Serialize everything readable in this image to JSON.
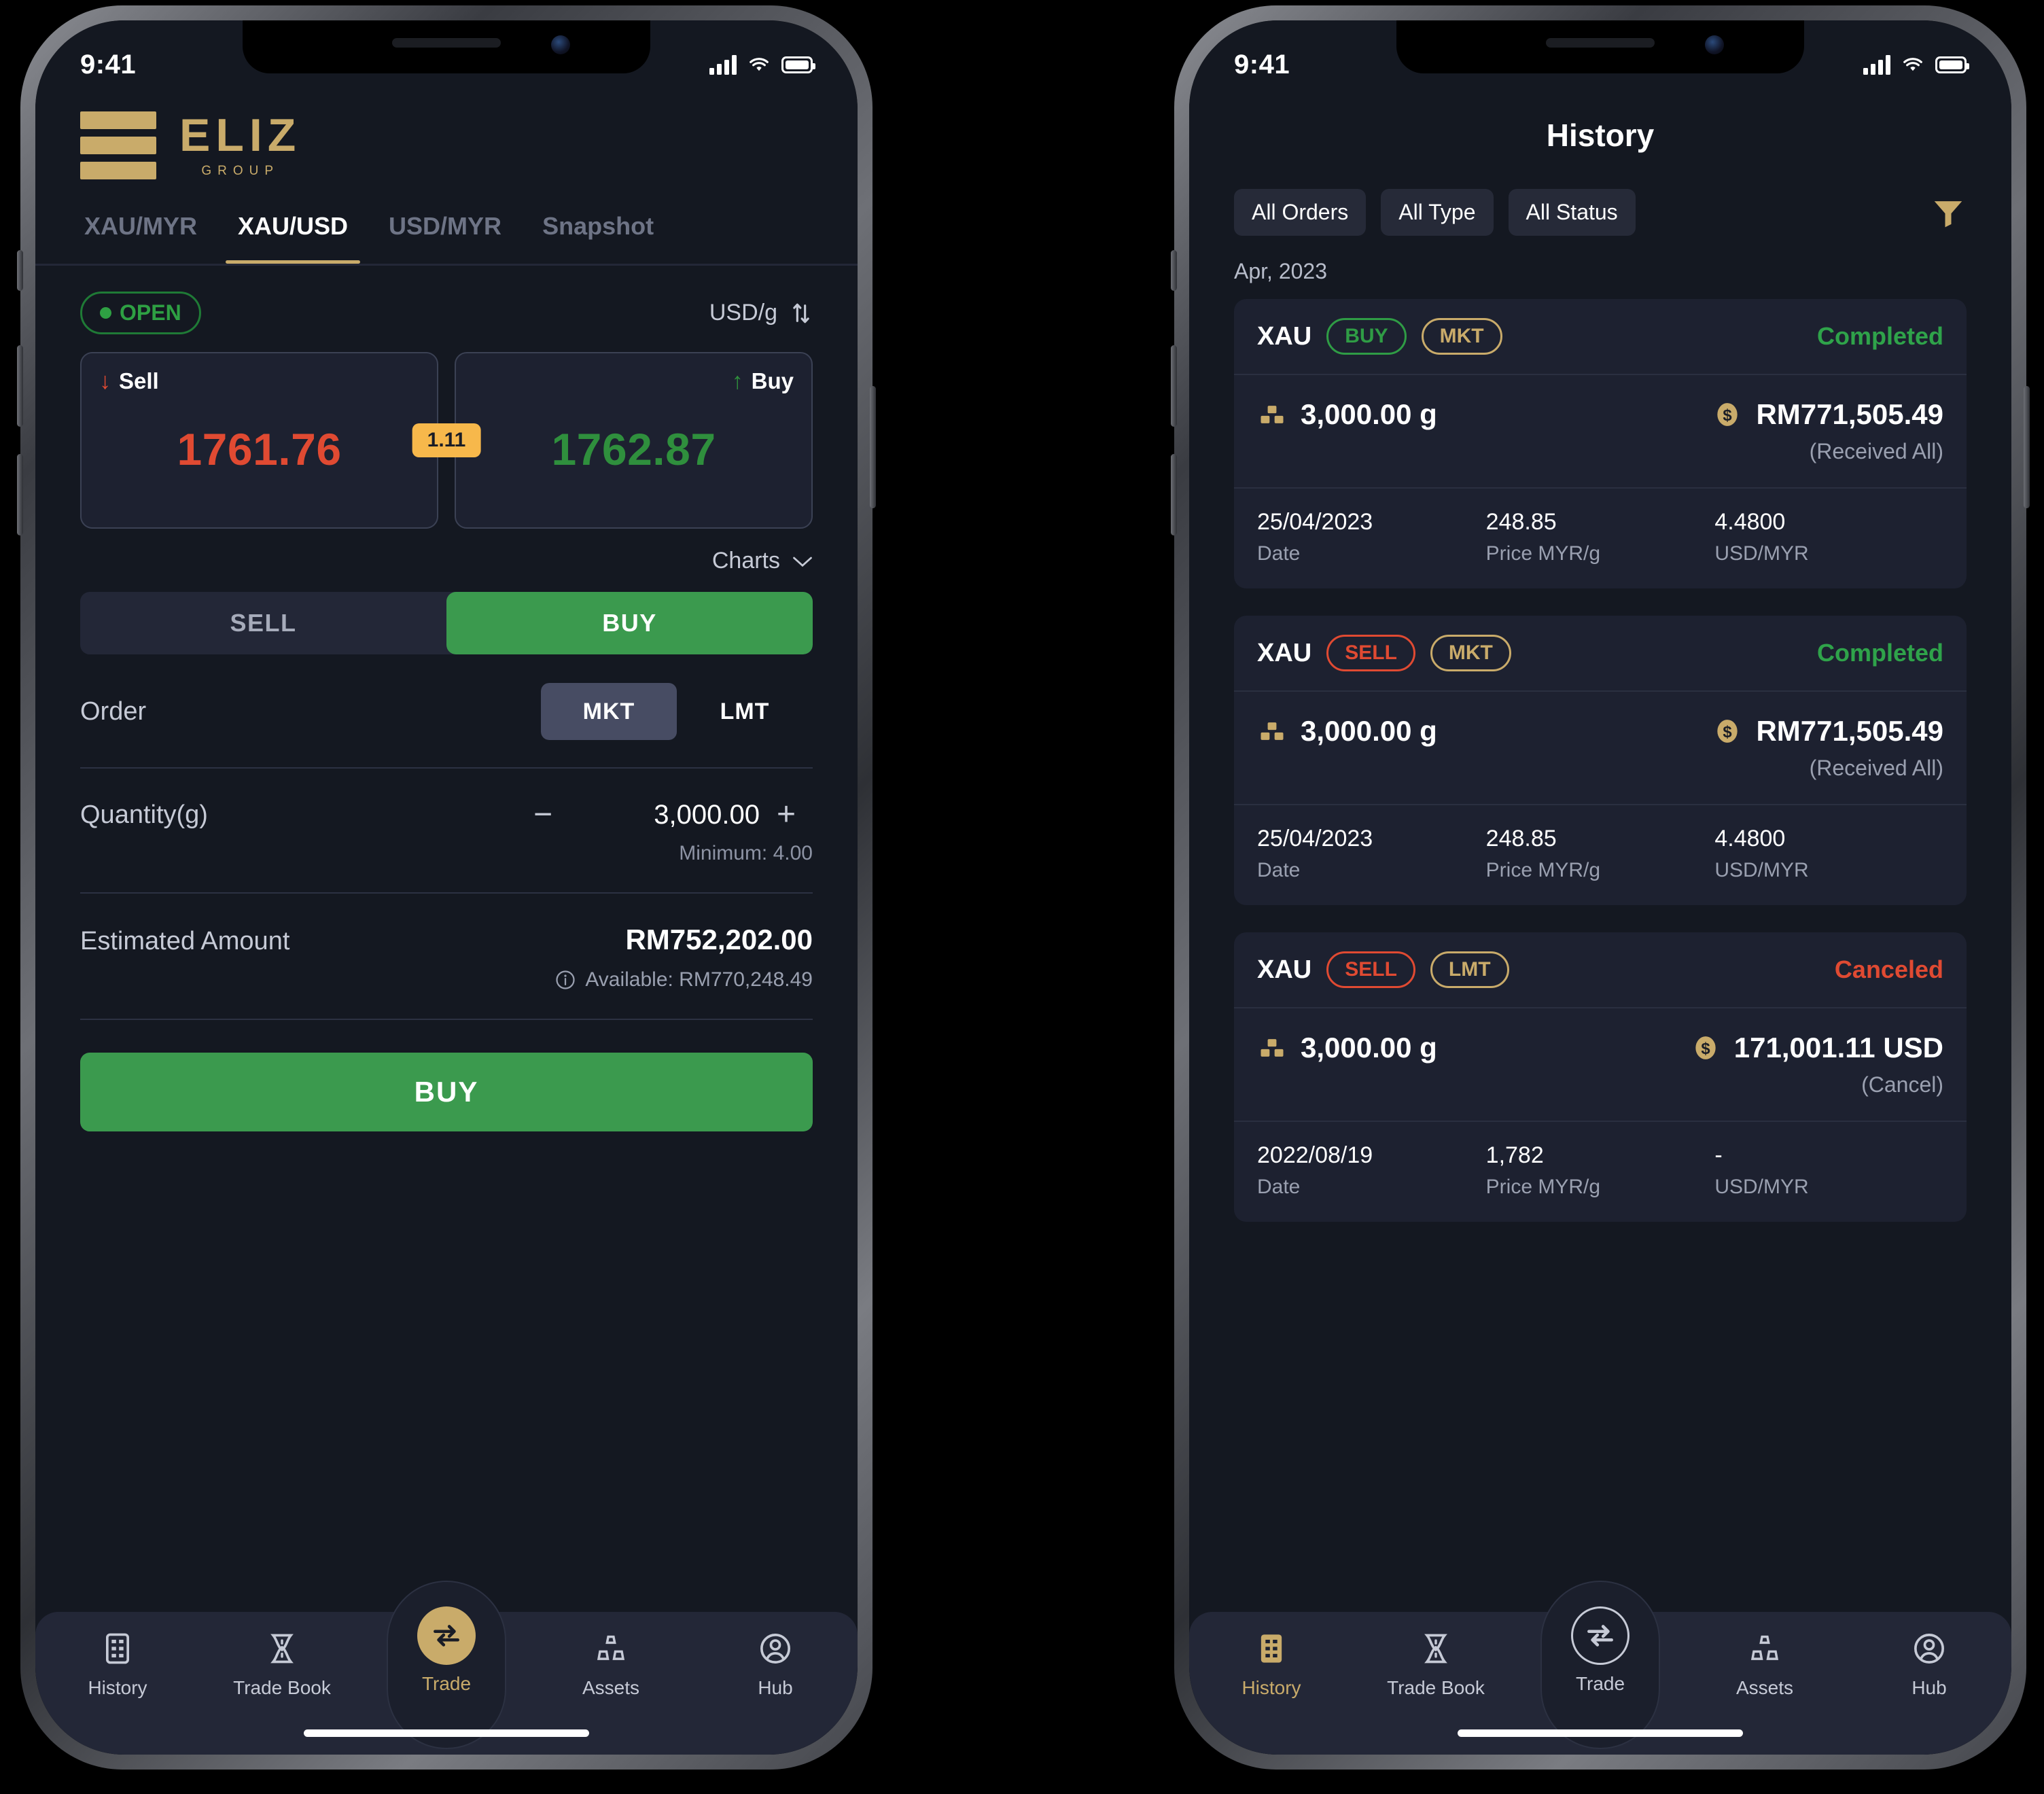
{
  "status_bar": {
    "time": "9:41",
    "signal_icon": "cellular-bars-icon",
    "wifi_icon": "wifi-icon",
    "battery_icon": "battery-icon"
  },
  "brand": {
    "name": "ELIZ",
    "sub": "GROUP",
    "color": "#c9ab6a"
  },
  "trade": {
    "tabs": [
      {
        "label": "XAU/MYR",
        "active": false
      },
      {
        "label": "XAU/USD",
        "active": true
      },
      {
        "label": "USD/MYR",
        "active": false
      },
      {
        "label": "Snapshot",
        "active": false
      }
    ],
    "market_status": "OPEN",
    "unit": "USD/g",
    "sell": {
      "label": "Sell",
      "price": "1761.76",
      "color": "#e04a32"
    },
    "buy": {
      "label": "Buy",
      "price": "1762.87",
      "color": "#2f8f3d"
    },
    "spread": "1.11",
    "spread_color": "#f7b84b",
    "charts_label": "Charts",
    "side_toggle": {
      "sell": "SELL",
      "buy": "BUY",
      "selected": "BUY"
    },
    "order_label": "Order",
    "order_types": {
      "mkt": "MKT",
      "lmt": "LMT",
      "selected": "MKT"
    },
    "quantity_label": "Quantity(g)",
    "quantity_value": "3,000.00",
    "minus": "−",
    "plus": "+",
    "minimum_note": "Minimum: 4.00",
    "estimated_label": "Estimated Amount",
    "estimated_value": "RM752,202.00",
    "available_note": "Available: RM770,248.49",
    "cta_label": "BUY"
  },
  "history": {
    "title": "History",
    "filters": [
      {
        "label": "All Orders"
      },
      {
        "label": "All Type"
      },
      {
        "label": "All Status"
      }
    ],
    "filter_icon": "funnel-icon",
    "month": "Apr, 2023",
    "col_labels": {
      "date": "Date",
      "price": "Price MYR/g",
      "fx": "USD/MYR"
    },
    "orders": [
      {
        "symbol": "XAU",
        "side": "BUY",
        "type": "MKT",
        "status": "Completed",
        "status_kind": "ok",
        "quantity": "3,000.00 g",
        "amount": "RM771,505.49",
        "note": "(Received All)",
        "date": "25/04/2023",
        "price": "248.85",
        "fx": "4.4800"
      },
      {
        "symbol": "XAU",
        "side": "SELL",
        "type": "MKT",
        "status": "Completed",
        "status_kind": "ok",
        "quantity": "3,000.00 g",
        "amount": "RM771,505.49",
        "note": "(Received All)",
        "date": "25/04/2023",
        "price": "248.85",
        "fx": "4.4800"
      },
      {
        "symbol": "XAU",
        "side": "SELL",
        "type": "LMT",
        "status": "Canceled",
        "status_kind": "cancel",
        "quantity": "3,000.00 g",
        "amount": "171,001.11 USD",
        "note": "(Cancel)",
        "date": "2022/08/19",
        "price": "1,782",
        "fx": "-"
      }
    ]
  },
  "nav": {
    "items": [
      {
        "label": "History",
        "icon": "history-list-icon"
      },
      {
        "label": "Trade Book",
        "icon": "trade-book-icon"
      },
      {
        "label": "Trade",
        "icon": "swap-arrows-icon"
      },
      {
        "label": "Assets",
        "icon": "assets-blocks-icon"
      },
      {
        "label": "Hub",
        "icon": "person-circle-icon"
      }
    ],
    "left_active": "Trade",
    "right_active": "History"
  }
}
